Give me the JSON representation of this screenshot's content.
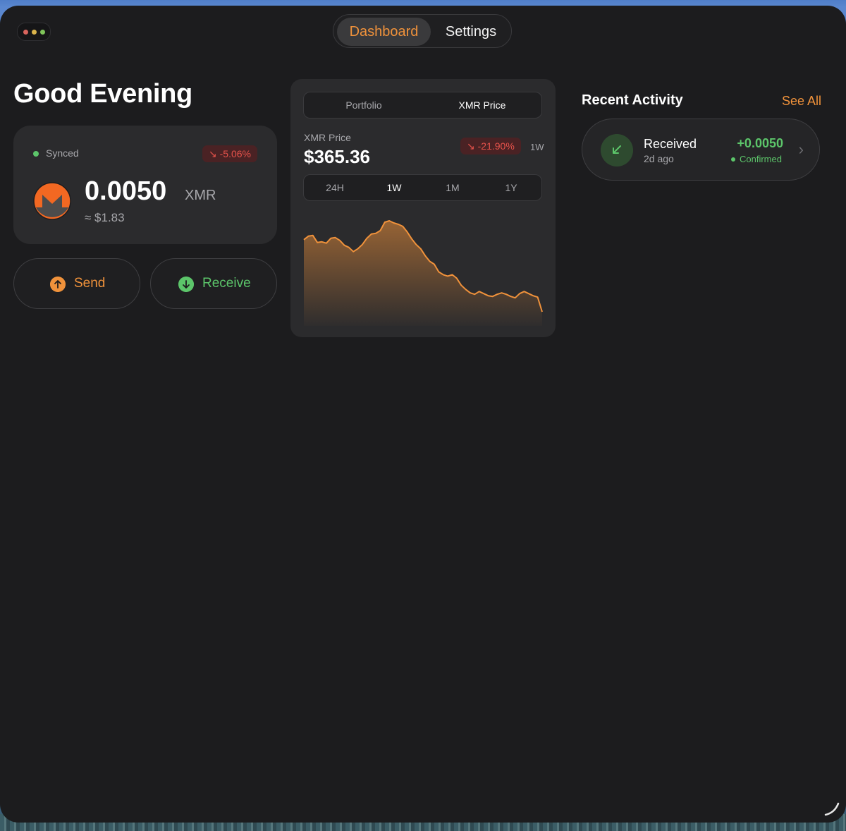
{
  "nav": {
    "tabs": [
      {
        "label": "Dashboard",
        "active": true
      },
      {
        "label": "Settings",
        "active": false
      }
    ]
  },
  "greeting": "Good Evening",
  "balance": {
    "status": "Synced",
    "change": "↘ -5.06%",
    "amount": "0.0050",
    "unit": "XMR",
    "fiat": "≈ $1.83",
    "logo_icon": "monero-logo"
  },
  "actions": {
    "send_label": "Send",
    "receive_label": "Receive"
  },
  "chart_card": {
    "tabs": [
      {
        "label": "Portfolio",
        "active": false
      },
      {
        "label": "XMR Price",
        "active": true
      }
    ],
    "price_label": "XMR Price",
    "price_value": "$365.36",
    "change": "↘ -21.90%",
    "period": "1W",
    "ranges": [
      {
        "label": "24H"
      },
      {
        "label": "1W",
        "active": true
      },
      {
        "label": "1M"
      },
      {
        "label": "1Y"
      }
    ]
  },
  "chart_data": {
    "type": "area",
    "values": [
      320,
      325,
      326,
      316,
      317,
      315,
      322,
      323,
      319,
      312,
      309,
      303,
      307,
      313,
      322,
      328,
      329,
      333,
      345,
      347,
      344,
      342,
      339,
      331,
      321,
      313,
      307,
      297,
      289,
      285,
      274,
      270,
      268,
      270,
      265,
      255,
      249,
      244,
      242,
      246,
      243,
      240,
      239,
      242,
      244,
      242,
      239,
      237,
      243,
      246,
      243,
      240,
      238,
      217
    ],
    "color": "#f0923b"
  },
  "activity": {
    "title": "Recent Activity",
    "see_all": "See All",
    "items": [
      {
        "label": "Received",
        "time": "2d ago",
        "amount": "+0.0050",
        "status": "Confirmed",
        "icon": "arrow-down-left-icon"
      }
    ]
  },
  "colors": {
    "accent": "#f0923b",
    "positive": "#5cc56a",
    "negative": "#e5524b",
    "background": "#1c1c1e",
    "card": "#2b2b2d"
  }
}
